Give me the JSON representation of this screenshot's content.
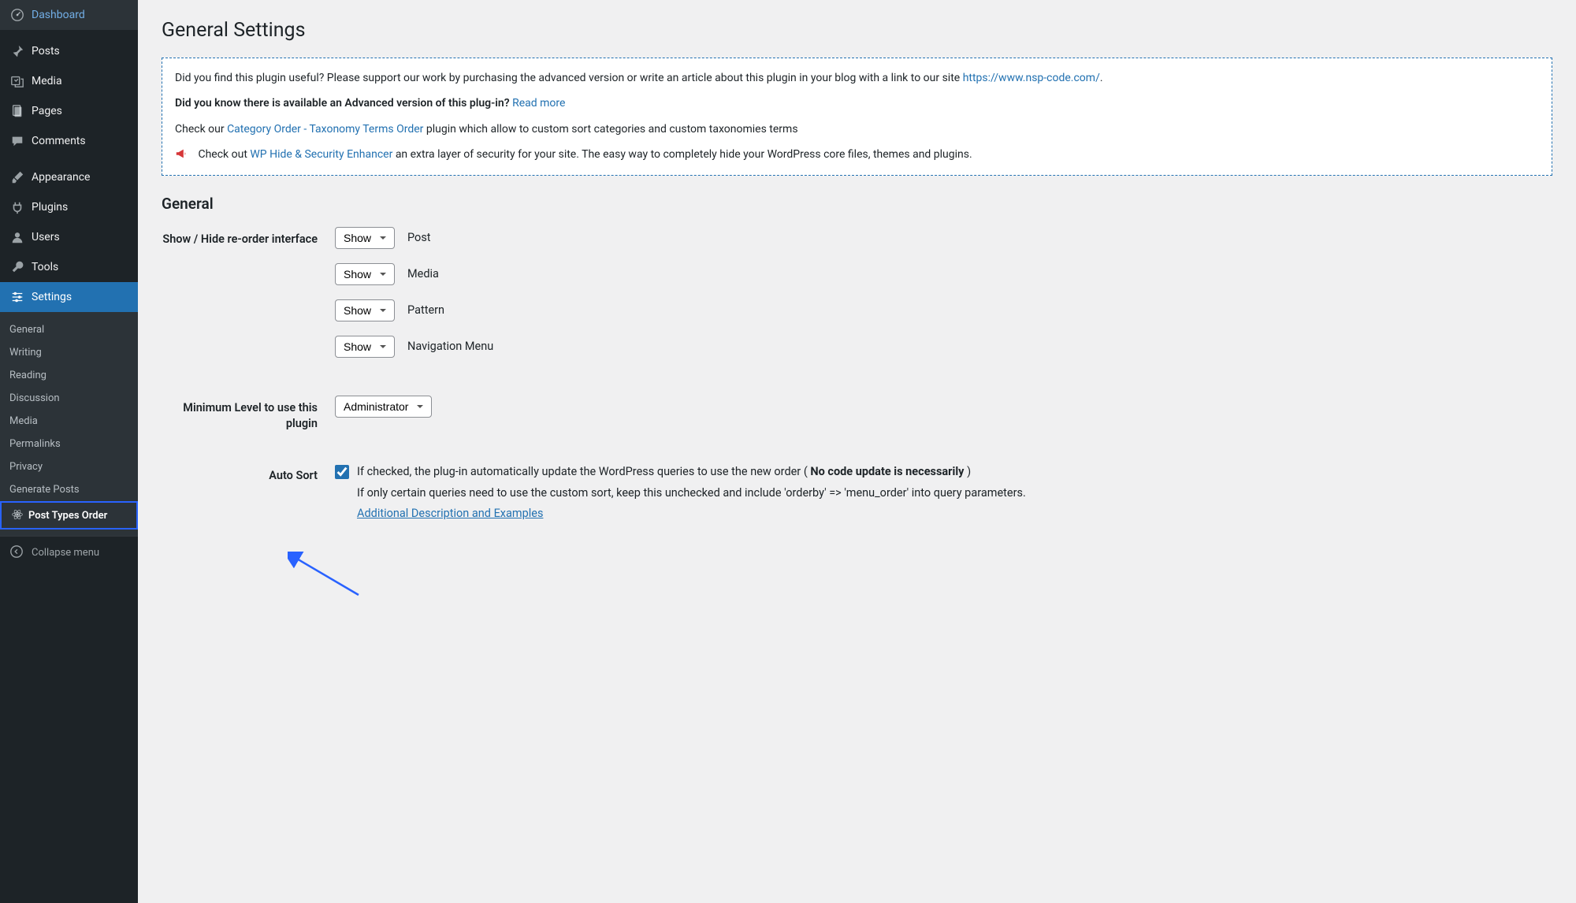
{
  "sidebar": {
    "main": [
      {
        "label": "Dashboard",
        "icon": "dashboard"
      },
      {
        "label": "Posts",
        "icon": "pin"
      },
      {
        "label": "Media",
        "icon": "media"
      },
      {
        "label": "Pages",
        "icon": "pages"
      },
      {
        "label": "Comments",
        "icon": "comments"
      }
    ],
    "admin": [
      {
        "label": "Appearance",
        "icon": "brush"
      },
      {
        "label": "Plugins",
        "icon": "plug"
      },
      {
        "label": "Users",
        "icon": "user"
      },
      {
        "label": "Tools",
        "icon": "wrench"
      },
      {
        "label": "Settings",
        "icon": "sliders",
        "active": true
      }
    ],
    "submenu": [
      {
        "label": "General"
      },
      {
        "label": "Writing"
      },
      {
        "label": "Reading"
      },
      {
        "label": "Discussion"
      },
      {
        "label": "Media"
      },
      {
        "label": "Permalinks"
      },
      {
        "label": "Privacy"
      },
      {
        "label": "Generate Posts"
      },
      {
        "label": "Post Types Order",
        "current": true,
        "highlighted": true
      }
    ],
    "collapse": "Collapse menu"
  },
  "page": {
    "title": "General Settings",
    "notice": {
      "p1_before": "Did you find this plugin useful? Please support our work by purchasing the advanced version or write an article about this plugin in your blog with a link to our site ",
      "p1_link": "https://www.nsp-code.com/",
      "p2_strong": "Did you know there is available an Advanced version of this plug-in?",
      "p2_link": "Read more",
      "p3_before": "Check our ",
      "p3_link": "Category Order - Taxonomy Terms Order",
      "p3_after": " plugin which allow to custom sort categories and custom taxonomies terms",
      "p4_before": "Check out ",
      "p4_link": "WP Hide & Security Enhancer",
      "p4_after": " an extra layer of security for your site. The easy way to completely hide your WordPress core files, themes and plugins."
    },
    "section_general": "General",
    "fields": {
      "reorder_label": "Show / Hide re-order interface",
      "reorder_items": [
        {
          "select": "Show",
          "label": "Post"
        },
        {
          "select": "Show",
          "label": "Media"
        },
        {
          "select": "Show",
          "label": "Pattern"
        },
        {
          "select": "Show",
          "label": "Navigation Menu"
        }
      ],
      "min_level_label": "Minimum Level to use this plugin",
      "min_level_value": "Administrator",
      "auto_sort_label": "Auto Sort",
      "auto_sort_checked": true,
      "auto_sort_desc1_before": "If checked, the plug-in automatically update the WordPress queries to use the new order ( ",
      "auto_sort_desc1_bold": "No code update is necessarily",
      "auto_sort_desc1_after": " )",
      "auto_sort_desc2": "If only certain queries need to use the custom sort, keep this unchecked and include 'orderby' => 'menu_order' into query parameters.",
      "auto_sort_link": "Additional Description and Examples"
    }
  }
}
